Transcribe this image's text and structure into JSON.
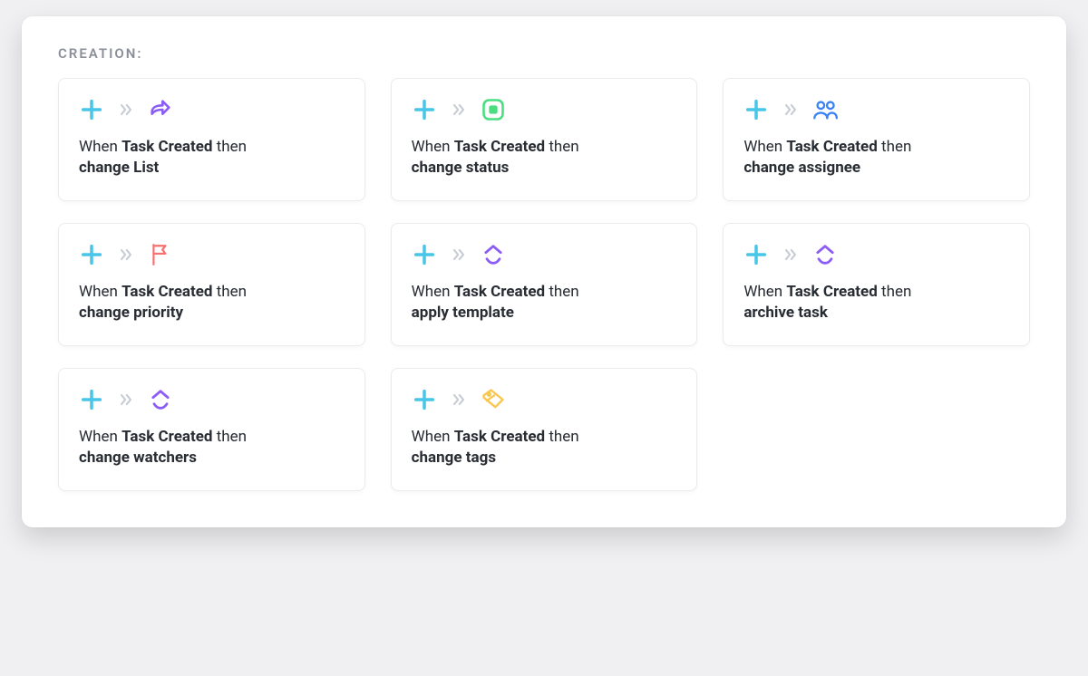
{
  "section": {
    "title": "CREATION:"
  },
  "text": {
    "prefix": "When",
    "then": "then",
    "trigger": "Task Created"
  },
  "cards": [
    {
      "id": "change-list",
      "action": "change List",
      "icon": "forward-arrow",
      "color": "#8b5cf6"
    },
    {
      "id": "change-status",
      "action": "change status",
      "icon": "status-square",
      "color": "#4ade80"
    },
    {
      "id": "change-assignee",
      "action": "change assignee",
      "icon": "people",
      "color": "#3b82f6"
    },
    {
      "id": "change-priority",
      "action": "change priority",
      "icon": "flag",
      "color": "#f87171"
    },
    {
      "id": "apply-template",
      "action": "apply template",
      "icon": "clickup",
      "color": "#8b5cf6"
    },
    {
      "id": "archive-task",
      "action": "archive task",
      "icon": "clickup",
      "color": "#8b5cf6"
    },
    {
      "id": "change-watchers",
      "action": "change watchers",
      "icon": "clickup",
      "color": "#8b5cf6"
    },
    {
      "id": "change-tags",
      "action": "change tags",
      "icon": "tag",
      "color": "#f9c74f"
    }
  ],
  "icons": {
    "trigger_color": "#49c5e8"
  }
}
